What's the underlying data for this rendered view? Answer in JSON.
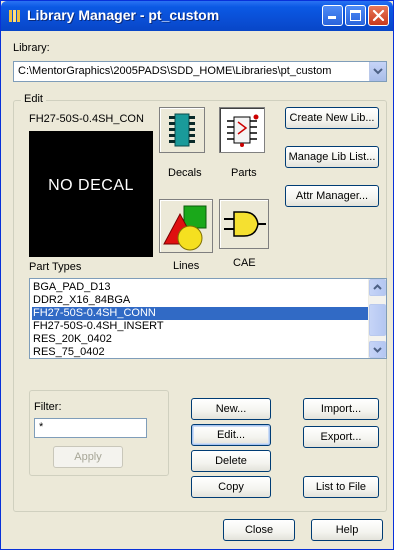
{
  "window": {
    "title": "Library Manager - pt_custom"
  },
  "library": {
    "label": "Library:",
    "path": "C:\\MentorGraphics\\2005PADS\\SDD_HOME\\Libraries\\pt_custom"
  },
  "edit": {
    "group_label": "Edit",
    "current_part": "FH27-50S-0.4SH_CON",
    "preview_text": "NO DECAL",
    "type_buttons": [
      {
        "label": "Decals",
        "icon": "decals-chip-icon",
        "active": false
      },
      {
        "label": "Parts",
        "icon": "parts-chip-icon",
        "active": true
      },
      {
        "label": "Lines",
        "icon": "lines-shapes-icon",
        "active": false
      },
      {
        "label": "CAE",
        "icon": "cae-gate-icon",
        "active": false
      }
    ],
    "side_buttons": {
      "create_new_lib": "Create New Lib...",
      "manage_lib_list": "Manage Lib List...",
      "attr_manager": "Attr Manager..."
    },
    "list_label": "Part Types",
    "part_types": [
      "BGA_PAD_D13",
      "DDR2_X16_84BGA",
      "FH27-50S-0.4SH_CONN",
      "FH27-50S-0.4SH_INSERT",
      "RES_20K_0402",
      "RES_75_0402"
    ],
    "selected_index": 2
  },
  "filter": {
    "label": "Filter:",
    "value": "*",
    "apply": "Apply"
  },
  "actions": {
    "new": "New...",
    "edit": "Edit...",
    "delete": "Delete",
    "copy": "Copy",
    "import": "Import...",
    "export": "Export...",
    "list_to_file": "List to File"
  },
  "footer": {
    "close": "Close",
    "help": "Help"
  },
  "colors": {
    "titlebar": "#0a4fd6",
    "selection": "#316ac5",
    "dialog_bg": "#ece9d8"
  }
}
